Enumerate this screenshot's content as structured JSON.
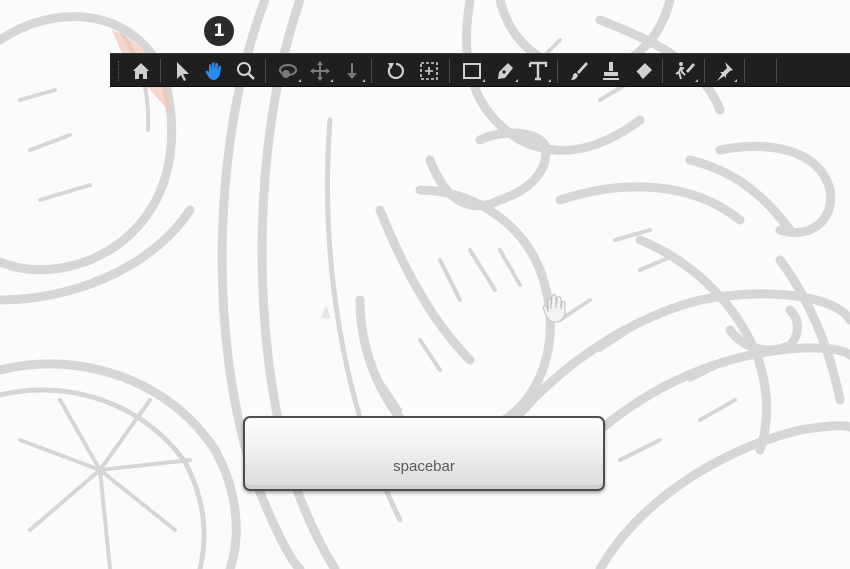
{
  "step_badge": "1",
  "key": {
    "label": "spacebar"
  },
  "toolbar": {
    "active_tool": "hand",
    "tools": [
      {
        "name": "home",
        "icon": "home-icon"
      },
      {
        "name": "selection",
        "icon": "arrow-cursor-icon"
      },
      {
        "name": "hand",
        "icon": "hand-icon"
      },
      {
        "name": "zoom",
        "icon": "zoom-icon"
      },
      {
        "name": "orbit",
        "icon": "orbit-icon"
      },
      {
        "name": "pan-behind",
        "icon": "move-cross-icon"
      },
      {
        "name": "anchor",
        "icon": "down-arrow-icon"
      },
      {
        "name": "rotate",
        "icon": "rotate-icon"
      },
      {
        "name": "camera-track",
        "icon": "track-box-icon"
      },
      {
        "name": "rectangle",
        "icon": "rectangle-icon"
      },
      {
        "name": "pen",
        "icon": "pen-icon"
      },
      {
        "name": "type",
        "icon": "text-icon"
      },
      {
        "name": "brush",
        "icon": "brush-icon"
      },
      {
        "name": "clone-stamp",
        "icon": "stamp-icon"
      },
      {
        "name": "eraser",
        "icon": "eraser-icon"
      },
      {
        "name": "roto-brush",
        "icon": "roto-brush-icon"
      },
      {
        "name": "puppet-pin",
        "icon": "pin-icon"
      }
    ]
  },
  "colors": {
    "toolbar_bg": "#1f1f1f",
    "active_tool": "#2d8ceb",
    "icon": "#d0d0d0",
    "icon_disabled": "#7a7a7a",
    "line_art": "#d6d6d6",
    "accent_red": "#f2b7a8"
  }
}
